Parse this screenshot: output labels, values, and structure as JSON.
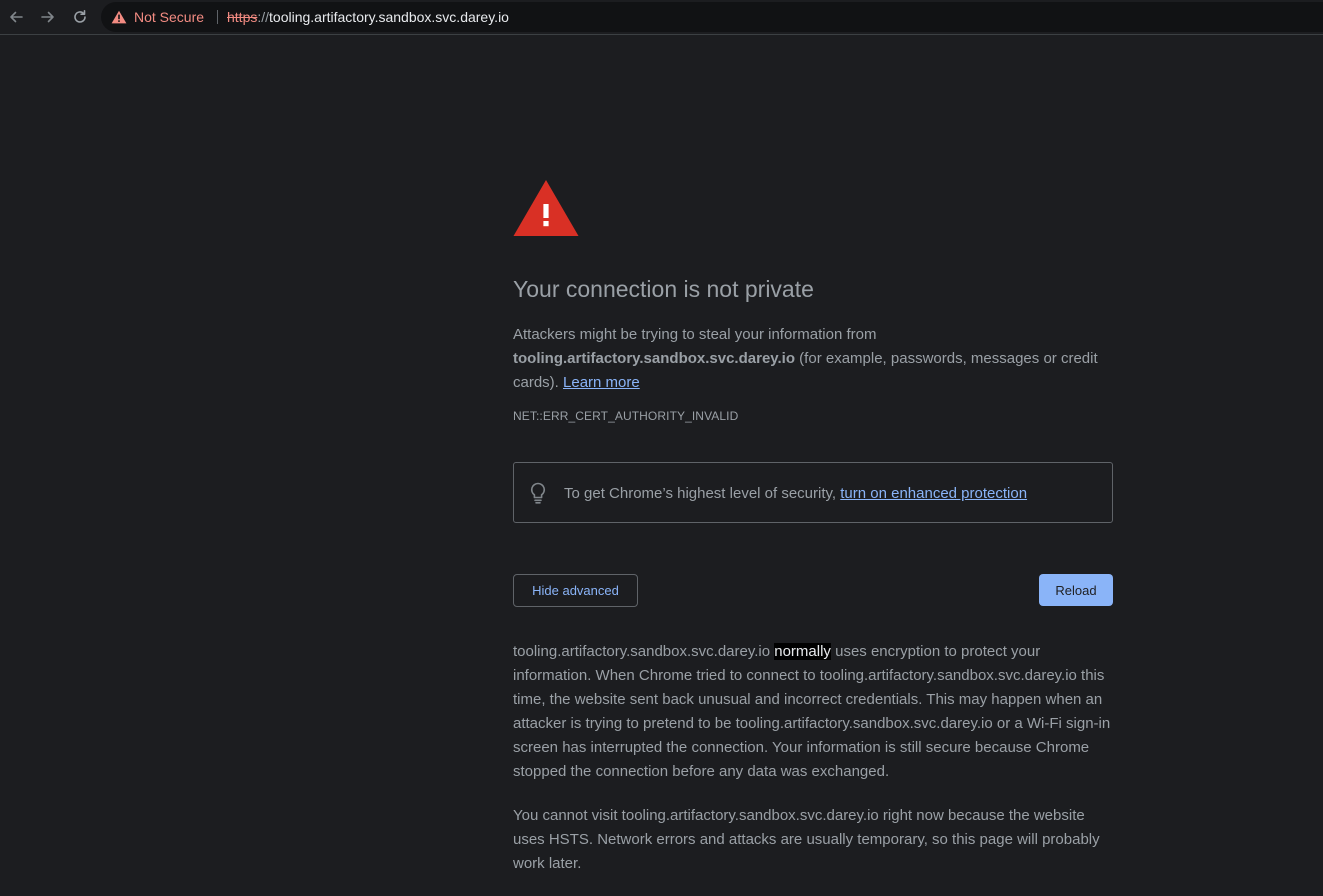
{
  "toolbar": {
    "back_icon": "arrow-left-icon",
    "forward_icon": "arrow-right-icon",
    "reload_icon": "reload-icon",
    "security_icon": "warning-triangle-icon",
    "security_label": "Not Secure",
    "url_scheme": "https",
    "url_separator": "://",
    "url_host": "tooling.artifactory.sandbox.svc.darey.io",
    "warning_color": "#f28b82"
  },
  "interstitial": {
    "warning_icon": "red-warning-triangle-icon",
    "warning_color": "#d93025",
    "heading": "Your connection is not private",
    "explanation": {
      "line1": "Attackers might be trying to steal your information from",
      "domain": "tooling.artifactory.sandbox.svc.darey.io",
      "rest": " (for example, passwords, messages or credit cards).",
      "learn_more": "Learn more"
    },
    "error_code": "NET::ERR_CERT_AUTHORITY_INVALID",
    "enhanced": {
      "icon": "lightbulb-icon",
      "text": "To get Chrome’s highest level of security,",
      "link": "turn on enhanced protection"
    },
    "hide_advanced_label": "Hide advanced",
    "reload_label": "Reload",
    "details": {
      "p1_domain": "tooling.artifactory.sandbox.svc.darey.io",
      "p1_highlight": "normally",
      "p1_rest": " uses encryption to protect your information. When Chrome tried to connect to tooling.artifactory.sandbox.svc.darey.io this time, the website sent back unusual and incorrect credentials. This may happen when an attacker is trying to pretend to be tooling.artifactory.sandbox.svc.darey.io or a Wi-Fi sign-in screen has interrupted the connection. Your information is still secure because Chrome stopped the connection before any data was exchanged.",
      "p2": "You cannot visit tooling.artifactory.sandbox.svc.darey.io right now because the website uses HSTS. Network errors and attacks are usually temporary, so this page will probably work later."
    },
    "accent_color": "#8ab4f8"
  }
}
